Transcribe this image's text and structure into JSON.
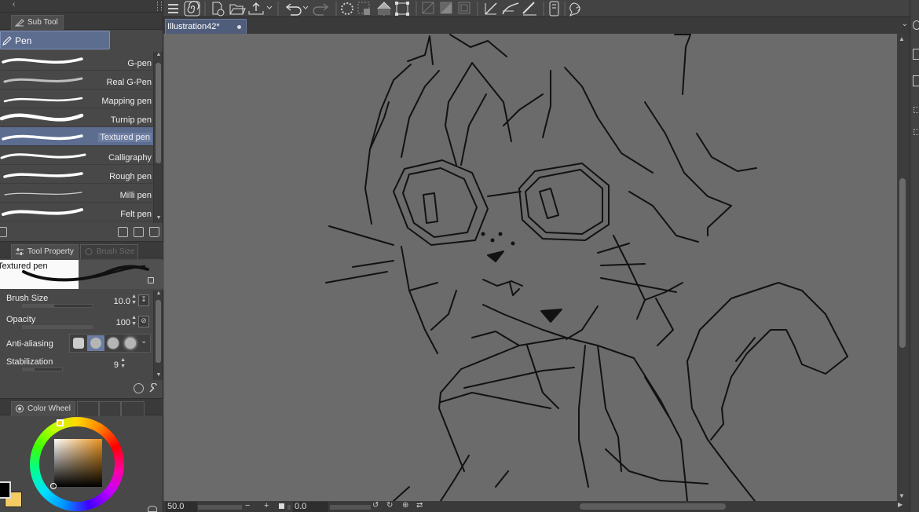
{
  "subtool": {
    "tab_label": "Sub Tool",
    "group_label": "Pen",
    "brushes": [
      {
        "name": "G-pen",
        "selected": false
      },
      {
        "name": "Real G-Pen",
        "selected": false
      },
      {
        "name": "Mapping pen",
        "selected": false
      },
      {
        "name": "Turnip pen",
        "selected": false
      },
      {
        "name": "Textured pen",
        "selected": true
      },
      {
        "name": "Calligraphy",
        "selected": false
      },
      {
        "name": "Rough pen",
        "selected": false
      },
      {
        "name": "Milli pen",
        "selected": false
      },
      {
        "name": "Felt pen",
        "selected": false
      }
    ]
  },
  "tool_property": {
    "tab_label": "Tool Property",
    "tab2_label": "Brush Size",
    "preview_name": "Textured pen",
    "brush_size": {
      "label": "Brush Size",
      "value": "10.0"
    },
    "opacity": {
      "label": "Opacity",
      "value": "100"
    },
    "anti_aliasing": {
      "label": "Anti-aliasing",
      "level": 1
    },
    "stabilization": {
      "label": "Stabilization",
      "value": "9"
    }
  },
  "color": {
    "tab_label": "Color Wheel",
    "main_color": "#000000",
    "sub_color": "#f2cc63"
  },
  "document": {
    "tab_title": "Illustration42*"
  },
  "status": {
    "zoom": "50.0",
    "rotation": "0.0"
  },
  "colors": {
    "accent": "#5c6d90",
    "canvas_bg": "#6b6b6b",
    "panel_bg": "#484848"
  },
  "icons": [
    "menu-icon",
    "new-file-icon",
    "open-folder-icon",
    "export-icon",
    "undo-icon",
    "redo-icon",
    "loading-icon",
    "transform-icon",
    "fill-icon",
    "pen-tool-icon",
    "device-icon",
    "help-icon"
  ]
}
